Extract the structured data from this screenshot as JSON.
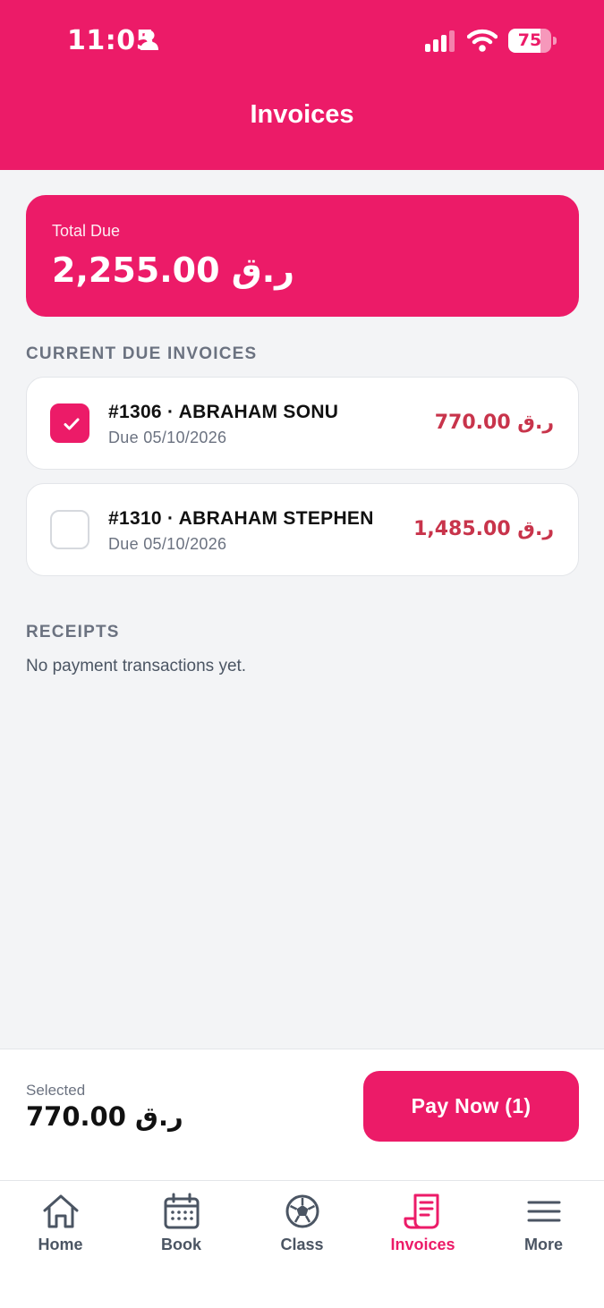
{
  "status_bar": {
    "time": "11:05",
    "battery_level": "75",
    "battery_fraction": 0.75
  },
  "header": {
    "title": "Invoices"
  },
  "total_due": {
    "label": "Total Due",
    "amount": "2,255.00 ر.ق"
  },
  "current_due": {
    "heading": "CURRENT DUE INVOICES",
    "invoices": [
      {
        "title": "#1306 · ABRAHAM SONU",
        "due": "Due 05/10/2026",
        "amount": "770.00 ر.ق",
        "checked": true
      },
      {
        "title": "#1310 · ABRAHAM STEPHEN",
        "due": "Due 05/10/2026",
        "amount": "1,485.00 ر.ق",
        "checked": false
      }
    ]
  },
  "receipts": {
    "heading": "RECEIPTS",
    "empty_text": "No payment transactions yet."
  },
  "checkout": {
    "selected_label": "Selected",
    "selected_amount": "770.00 ر.ق",
    "pay_button_label": "Pay Now (1)"
  },
  "tabs": [
    {
      "label": "Home",
      "icon": "home-icon",
      "active": false
    },
    {
      "label": "Book",
      "icon": "calendar-icon",
      "active": false
    },
    {
      "label": "Class",
      "icon": "soccer-ball-icon",
      "active": false
    },
    {
      "label": "Invoices",
      "icon": "invoice-icon",
      "active": true
    },
    {
      "label": "More",
      "icon": "menu-icon",
      "active": false
    }
  ],
  "colors": {
    "brand": "#ec1b68",
    "amount_red": "#c8344b",
    "background": "#f3f4f6",
    "muted_text": "#6b7280"
  }
}
